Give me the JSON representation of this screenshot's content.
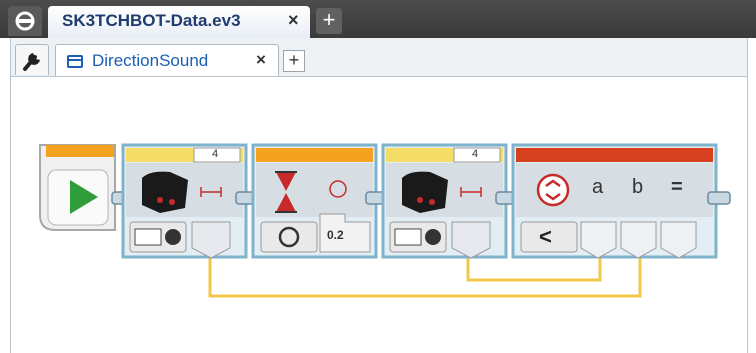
{
  "project_tab": {
    "title": "SK3TCHBOT-Data.ev3",
    "close": "×",
    "add": "+"
  },
  "program_tab": {
    "title": "DirectionSound",
    "close": "×",
    "add": "+"
  },
  "blocks": {
    "sensor1_port": "4",
    "sensor2_port": "4",
    "wait_value": "0.2",
    "compare_a": "a",
    "compare_b": "b",
    "compare_eq": "=",
    "compare_op": "<"
  },
  "colors": {
    "wire": "#f2c84b",
    "start_green": "#2e9d3a",
    "block_orange": "#f4a21f",
    "compare_red": "#d63a1c"
  }
}
